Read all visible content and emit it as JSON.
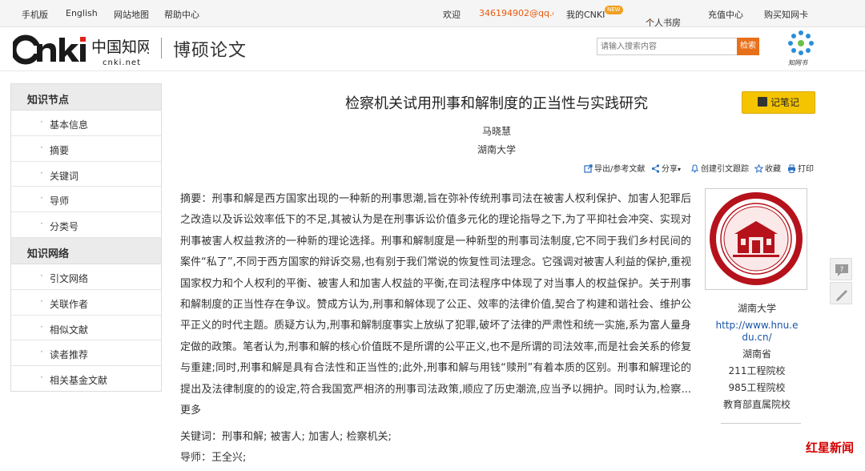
{
  "topbar": {
    "mobile": "手机版",
    "english": "English",
    "sitemap": "网站地图",
    "help": "帮助中心",
    "welcome": "欢迎",
    "account": "346194902@qq.co",
    "my_cnki": "我的CNKI",
    "new_badge": "NEW",
    "personal_library": "个人书房",
    "recharge": "充值中心",
    "buy_card": "购买知网卡"
  },
  "header": {
    "logo_text": "cnki.net",
    "site_title": "博硕论文",
    "search_placeholder": "请输入搜索内容",
    "search_button": "检索",
    "app_label": "知网书"
  },
  "sidebar": {
    "section1": "知识节点",
    "items1": [
      "基本信息",
      "摘要",
      "关键词",
      "导师",
      "分类号"
    ],
    "section2": "知识网络",
    "items2": [
      "引文网络",
      "关联作者",
      "相似文献",
      "读者推荐",
      "相关基金文献"
    ]
  },
  "paper": {
    "title": "检察机关试用刑事和解制度的正当性与实践研究",
    "author": "马晓慧",
    "institution": "湖南大学",
    "note_button": "记笔记",
    "actions": {
      "export": "导出/参考文献",
      "share": "分享",
      "track": "创建引文跟踪",
      "favorite": "收藏",
      "print": "打印"
    },
    "abstract_label": "摘要：",
    "abstract": "刑事和解是西方国家出现的一种新的刑事思潮,旨在弥补传统刑事司法在被害人权利保护、加害人犯罪后之改造以及诉讼效率低下的不足,其被认为是在刑事诉讼价值多元化的理论指导之下,为了平抑社会冲突、实现对刑事被害人权益救济的一种新的理论选择。刑事和解制度是一种新型的刑事司法制度,它不同于我们乡村民间的案件“私了”,不同于西方国家的辩诉交易,也有别于我们常说的恢复性司法理念。它强调对被害人利益的保护,重视国家权力和个人权利的平衡、被害人和加害人权益的平衡,在司法程序中体现了对当事人的权益保护。关于刑事和解制度的正当性存在争议。赞成方认为,刑事和解体现了公正、效率的法律价值,契合了构建和谐社会、维护公平正义的时代主题。质疑方认为,刑事和解制度事实上放纵了犯罪,破坏了法律的严肃性和统一实施,系为富人量身定做的政策。笔者认为,刑事和解的核心价值既不是所谓的公平正义,也不是所谓的司法效率,而是社会关系的修复与重建;同时,刑事和解是具有合法性和正当性的;此外,刑事和解与用钱“赎刑”有着本质的区别。刑事和解理论的提出及法律制度的的设定,符合我国宽严相济的刑事司法政策,顺应了历史潮流,应当予以拥护。同时认为,检察...",
    "more": "更多",
    "keywords_label": "关键词：",
    "keywords": "刑事和解; 被害人; 加害人; 检察机关;",
    "advisor_label": "导师：",
    "advisor": "王全兴;"
  },
  "institution_panel": {
    "name": "湖南大学",
    "url": "http://www.hnu.edu.cn/",
    "province": "湖南省",
    "tag1": "211工程院校",
    "tag2": "985工程院校",
    "tag3": "教育部直属院校"
  },
  "watermark": "红星新闻",
  "colors": {
    "accent_orange": "#e8701a",
    "note_yellow": "#f5c400",
    "link_blue": "#1a55a8",
    "seal_red": "#b5121b"
  }
}
